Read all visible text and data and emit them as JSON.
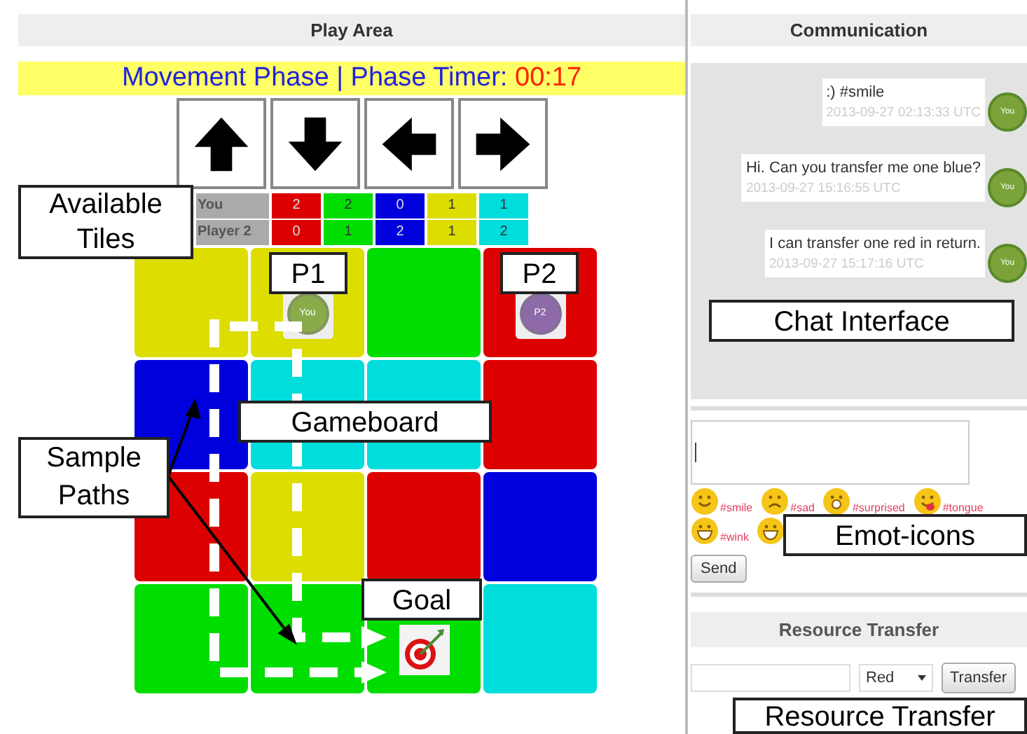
{
  "play_area": {
    "title": "Play Area",
    "phase_banner": {
      "phase_text": "Movement Phase | Phase Timer:",
      "timer": "00:17"
    },
    "move_buttons": [
      {
        "kind": "up"
      },
      {
        "kind": "down"
      },
      {
        "kind": "left"
      },
      {
        "kind": "right"
      }
    ],
    "tiles_table": {
      "columns": [
        {
          "color": "#dd0000"
        },
        {
          "color": "#00dd00"
        },
        {
          "color": "#0000dd"
        },
        {
          "color": "#dddd00"
        },
        {
          "color": "#00dddd"
        }
      ],
      "rows": [
        {
          "player": "You",
          "counts": [
            "2",
            "2",
            "0",
            "1",
            "1"
          ]
        },
        {
          "player": "Player 2",
          "counts": [
            "0",
            "1",
            "2",
            "1",
            "2"
          ]
        }
      ]
    },
    "gameboard": [
      [
        {
          "color": "#dddd00"
        },
        {
          "color": "#dddd00",
          "piece": {
            "kind": "player",
            "label": "You",
            "color": "#8aab4a"
          }
        },
        {
          "color": "#00dd00"
        },
        {
          "color": "#dd0000",
          "piece": {
            "kind": "player",
            "label": "P2",
            "color": "#8e6aa8"
          }
        }
      ],
      [
        {
          "color": "#0000dd"
        },
        {
          "color": "#00dddd"
        },
        {
          "color": "#00dddd"
        },
        {
          "color": "#dd0000"
        }
      ],
      [
        {
          "color": "#dd0000"
        },
        {
          "color": "#dddd00"
        },
        {
          "color": "#dd0000"
        },
        {
          "color": "#0000dd"
        }
      ],
      [
        {
          "color": "#00dd00"
        },
        {
          "color": "#00dd00"
        },
        {
          "color": "#00dd00",
          "piece": {
            "kind": "goal"
          }
        },
        {
          "color": "#00dddd"
        }
      ]
    ]
  },
  "communication": {
    "title": "Communication",
    "messages": [
      {
        "text": ":) #smile",
        "time": "2013-09-27 02:13:33 UTC",
        "avatar": "You"
      },
      {
        "text": "Hi. Can you transfer me one blue?",
        "time": "2013-09-27 15:16:55 UTC",
        "avatar": "You"
      },
      {
        "text": "I can transfer one red in return.",
        "time": "2013-09-27 15:17:16 UTC",
        "avatar": "You"
      }
    ],
    "emoticons": [
      {
        "kind": "smile",
        "label": "#smile"
      },
      {
        "kind": "sad",
        "label": "#sad"
      },
      {
        "kind": "surprised",
        "label": "#surprised"
      },
      {
        "kind": "tongue",
        "label": "#tongue"
      },
      {
        "kind": "grin",
        "label": "#wink"
      },
      {
        "kind": "grin"
      }
    ],
    "send_button": "Send"
  },
  "resource_transfer": {
    "title": "Resource Transfer",
    "color_select": "Red",
    "transfer_button": "Transfer"
  },
  "annotations": [
    {
      "text": "Available Tiles",
      "kind": "tiles"
    },
    {
      "text": "Sample Paths",
      "kind": "paths"
    },
    {
      "text": "P1",
      "kind": "p1"
    },
    {
      "text": "P2",
      "kind": "p2"
    },
    {
      "text": "Gameboard",
      "kind": "board"
    },
    {
      "text": "Goal",
      "kind": "goal"
    },
    {
      "text": "Chat Interface",
      "kind": "chat"
    },
    {
      "text": "Emot-icons",
      "kind": "emoticons"
    },
    {
      "text": "Resource Transfer",
      "kind": "transfer"
    }
  ]
}
